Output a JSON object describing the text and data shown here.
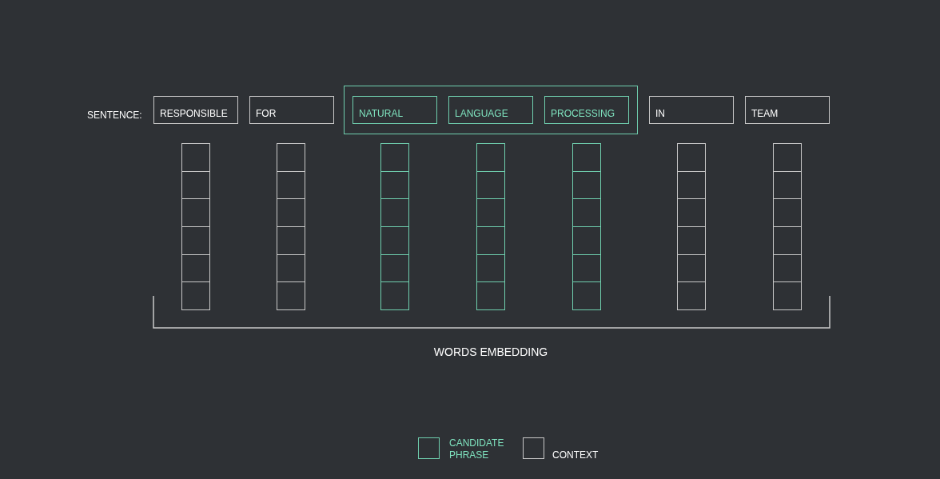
{
  "sentence_label": "SENTENCE:",
  "words": [
    {
      "text": "RESPONSIBLE",
      "kind": "context"
    },
    {
      "text": "FOR",
      "kind": "context"
    },
    {
      "text": "NATURAL",
      "kind": "candidate"
    },
    {
      "text": "LANGUAGE",
      "kind": "candidate"
    },
    {
      "text": "PROCESSING",
      "kind": "candidate"
    },
    {
      "text": "IN",
      "kind": "context"
    },
    {
      "text": "TEAM",
      "kind": "context"
    }
  ],
  "embedding_label": "WORDS EMBEDDING",
  "legend": [
    {
      "label": "CANDIDATE\nPHRASE",
      "kind": "candidate"
    },
    {
      "label": "CONTEXT",
      "kind": "context"
    }
  ]
}
